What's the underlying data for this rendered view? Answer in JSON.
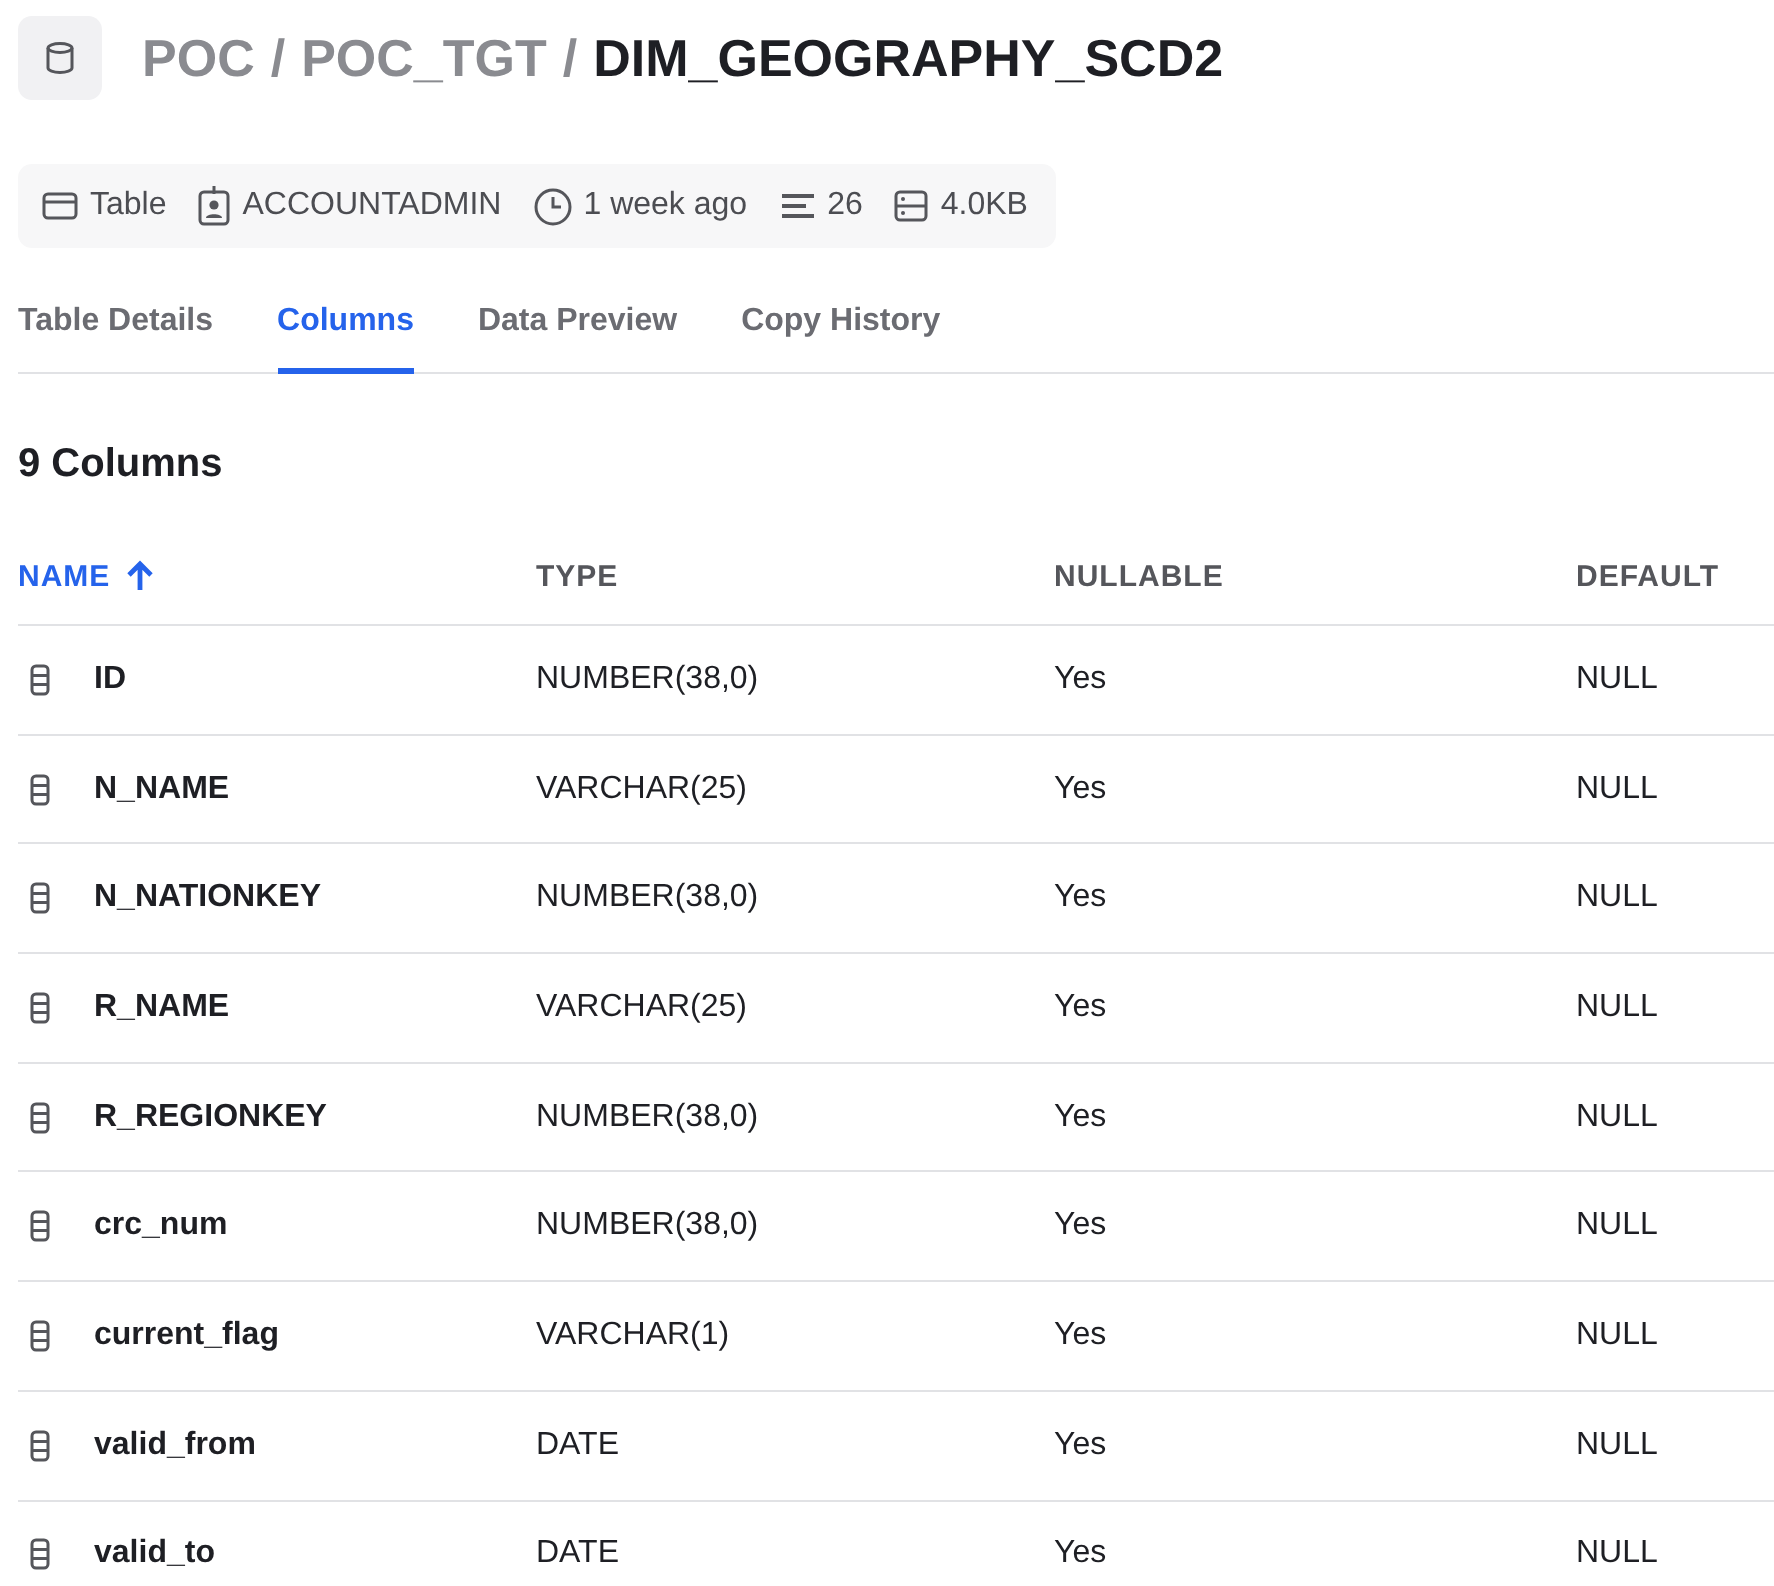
{
  "breadcrumb": [
    {
      "label": "POC",
      "current": false
    },
    {
      "label": "POC_TGT",
      "current": false
    },
    {
      "label": "DIM_GEOGRAPHY_SCD2",
      "current": true
    }
  ],
  "separator": "/",
  "meta": [
    {
      "kind": "type",
      "text": "Table"
    },
    {
      "kind": "owner",
      "text": "ACCOUNTADMIN"
    },
    {
      "kind": "time",
      "text": "1 week ago"
    },
    {
      "kind": "rows",
      "text": "26"
    },
    {
      "kind": "size",
      "text": "4.0KB"
    }
  ],
  "tabs": [
    {
      "label": "Table Details",
      "selected": false
    },
    {
      "label": "Columns",
      "selected": true
    },
    {
      "label": "Data Preview",
      "selected": false
    },
    {
      "label": "Copy History",
      "selected": false
    }
  ],
  "section_title": "9 Columns",
  "table": {
    "columns": [
      {
        "label": "NAME",
        "sorted": true
      },
      {
        "label": "TYPE",
        "sorted": false
      },
      {
        "label": "NULLABLE",
        "sorted": false
      },
      {
        "label": "DEFAULT",
        "sorted": false
      }
    ],
    "rows": [
      [
        "ID",
        "NUMBER(38,0)",
        "Yes",
        "NULL"
      ],
      [
        "N_NAME",
        "VARCHAR(25)",
        "Yes",
        "NULL"
      ],
      [
        "N_NATIONKEY",
        "NUMBER(38,0)",
        "Yes",
        "NULL"
      ],
      [
        "R_NAME",
        "VARCHAR(25)",
        "Yes",
        "NULL"
      ],
      [
        "R_REGIONKEY",
        "NUMBER(38,0)",
        "Yes",
        "NULL"
      ],
      [
        "crc_num",
        "NUMBER(38,0)",
        "Yes",
        "NULL"
      ],
      [
        "current_flag",
        "VARCHAR(1)",
        "Yes",
        "NULL"
      ],
      [
        "valid_from",
        "DATE",
        "Yes",
        "NULL"
      ],
      [
        "valid_to",
        "DATE",
        "Yes",
        "NULL"
      ]
    ]
  }
}
